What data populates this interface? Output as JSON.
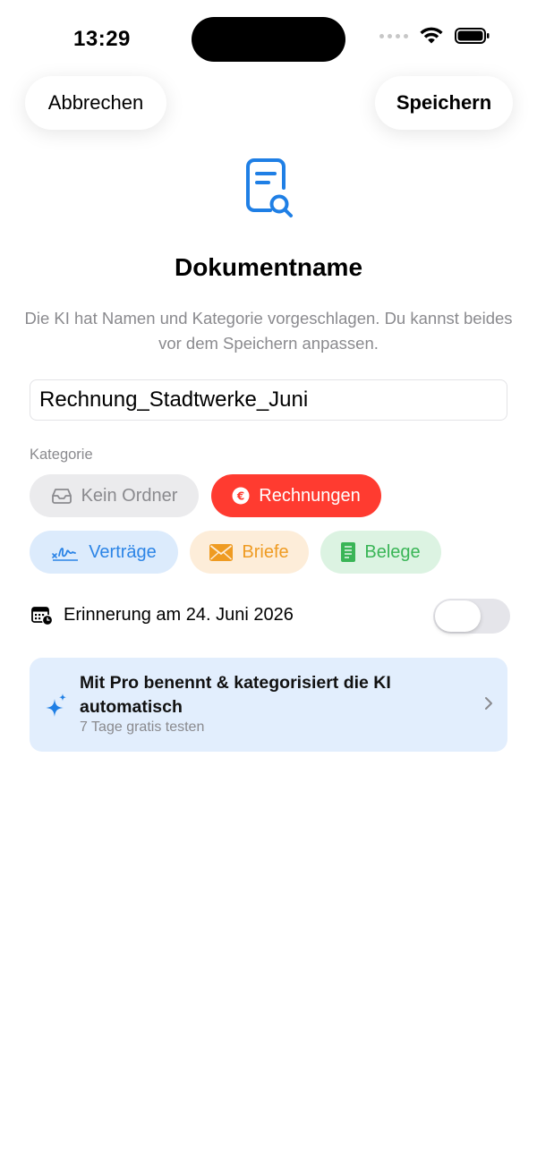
{
  "status_bar": {
    "time": "13:29"
  },
  "nav": {
    "cancel_label": "Abbrechen",
    "save_label": "Speichern"
  },
  "header": {
    "title": "Dokumentname",
    "subtitle": "Die KI hat Namen und Kategorie vorgeschlagen. Du kannst beides vor dem Speichern anpassen."
  },
  "document": {
    "name_value": "Rechnung_Stadtwerke_Juni"
  },
  "category": {
    "label": "Kategorie",
    "selected": "Rechnungen",
    "chips": [
      {
        "label": "Kein Ordner",
        "icon": "tray-icon",
        "color": "#8a8a8e",
        "bg": "#ebebed"
      },
      {
        "label": "Rechnungen",
        "icon": "euro-circle-icon",
        "color": "#ffffff",
        "bg": "#ff3b30"
      },
      {
        "label": "Verträge",
        "icon": "signature-icon",
        "color": "#2b84e6",
        "bg": "#dcebfc"
      },
      {
        "label": "Briefe",
        "icon": "envelope-icon",
        "color": "#ef9b22",
        "bg": "#fdedd9"
      },
      {
        "label": "Belege",
        "icon": "receipt-icon",
        "color": "#39b556",
        "bg": "#dcf3e2"
      }
    ]
  },
  "reminder": {
    "label": "Erinnerung am 24. Juni 2026",
    "enabled": false
  },
  "pro_banner": {
    "title": "Mit Pro benennt & kategorisiert die KI automatisch",
    "subtitle": "7 Tage gratis testen"
  },
  "colors": {
    "accent": "#1f7fe5",
    "selected_chip": "#ff3b30"
  }
}
